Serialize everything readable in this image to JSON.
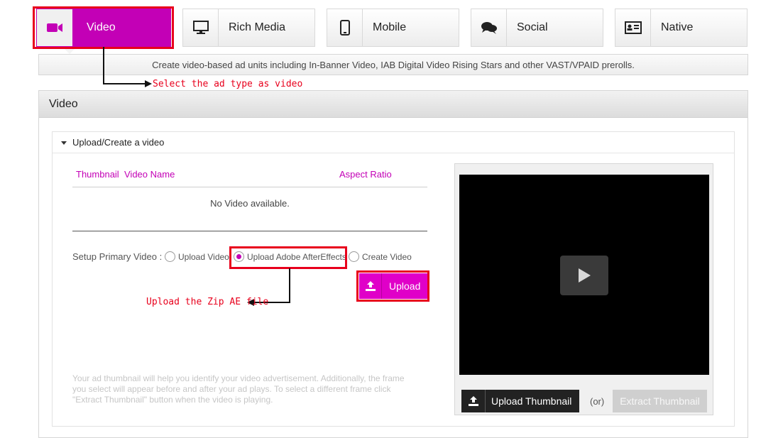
{
  "tabs": [
    {
      "label": "Video",
      "icon": "video-camera-icon",
      "active": true
    },
    {
      "label": "Rich Media",
      "icon": "monitor-icon",
      "active": false
    },
    {
      "label": "Mobile",
      "icon": "mobile-phone-icon",
      "active": false
    },
    {
      "label": "Social",
      "icon": "chat-bubbles-icon",
      "active": false
    },
    {
      "label": "Native",
      "icon": "id-card-icon",
      "active": false
    }
  ],
  "description": "Create video-based ad units including In-Banner Video, IAB Digital Video Rising Stars and other VAST/VPAID prerolls.",
  "annotations": {
    "select_ad_type": "Select the ad type as video",
    "upload_zip": "Upload the Zip AE file"
  },
  "panel": {
    "title": "Video",
    "section_title": "Upload/Create a video",
    "table": {
      "headers": [
        "Thumbnail",
        "Video Name",
        "Aspect Ratio"
      ],
      "empty_message": "No Video available."
    },
    "setup": {
      "label": "Setup Primary Video :",
      "options": [
        "Upload Video",
        "Upload Adobe AfterEffects",
        "Create Video"
      ],
      "selected": "Upload Adobe AfterEffects"
    },
    "upload_label": "Upload",
    "hint": "Your ad thumbnail will help you identify your video advertisement. Additionally, the frame you select will appear before and after your ad plays. To select a different frame click \"Extract Thumbnail\" button when the video is playing."
  },
  "player": {
    "upload_thumbnail_label": "Upload Thumbnail",
    "or_label": "(or)",
    "extract_thumbnail_label": "Extract Thumbnail"
  },
  "colors": {
    "accent": "#c300b6",
    "annotation": "#e8001c"
  }
}
